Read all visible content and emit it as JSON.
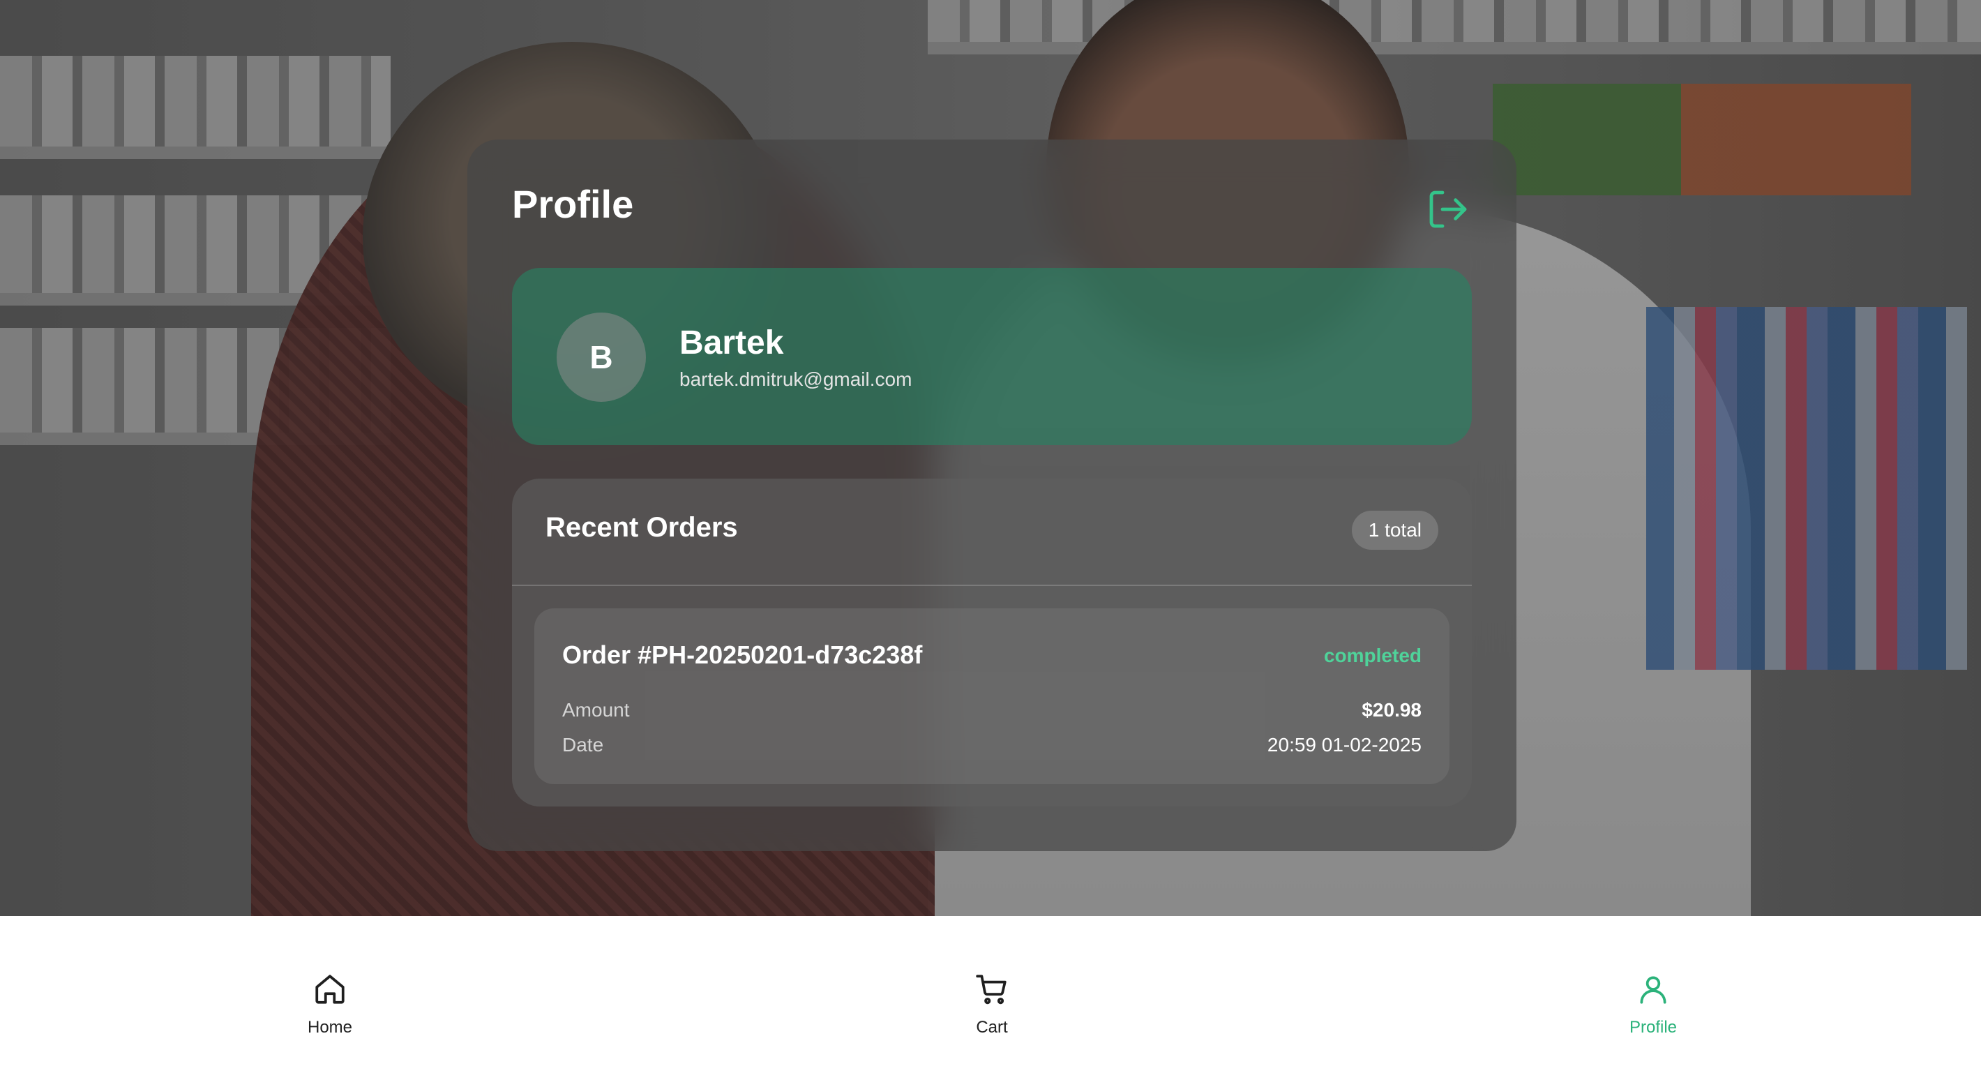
{
  "page": {
    "title": "Profile"
  },
  "user": {
    "initial": "B",
    "name": "Bartek",
    "email": "bartek.dmitruk@gmail.com"
  },
  "orders": {
    "title": "Recent Orders",
    "count_label": "1 total",
    "items": [
      {
        "id_label": "Order #PH-20250201-d73c238f",
        "status": "completed",
        "amount_label": "Amount",
        "amount_value": "$20.98",
        "date_label": "Date",
        "date_value": "20:59 01-02-2025"
      }
    ]
  },
  "nav": {
    "items": [
      {
        "label": "Home",
        "icon": "home-icon",
        "active": false
      },
      {
        "label": "Cart",
        "icon": "cart-icon",
        "active": false
      },
      {
        "label": "Profile",
        "icon": "user-icon",
        "active": true
      }
    ]
  },
  "colors": {
    "accent": "#2bb27a",
    "status_completed": "#4fd39a",
    "logout_icon": "#34c48a"
  },
  "icons": {
    "logout": "logout-icon"
  }
}
